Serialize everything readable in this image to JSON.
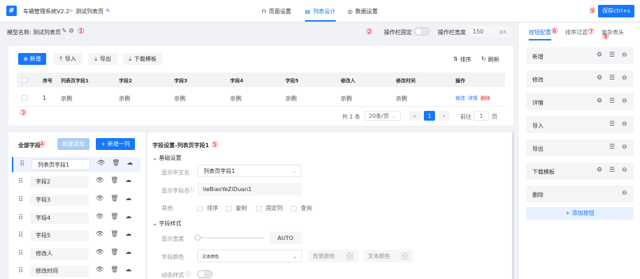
{
  "topbar": {
    "crumbs": [
      "车辆管理系统V2.2",
      ">",
      "测试列表页"
    ],
    "tabs": [
      {
        "label": "页面设置",
        "icon": "bookmark-icon"
      },
      {
        "label": "列表设计",
        "icon": "document-icon"
      },
      {
        "label": "数据设置",
        "icon": "database-icon"
      }
    ],
    "active_tab": 1,
    "save_label": "保存ctrl+s",
    "marker": "⑨"
  },
  "model": {
    "label": "模型名称:",
    "name": "测试列表页",
    "marker": "①",
    "fixed_label": "操作栏固定",
    "fixed_marker": "②",
    "width_label": "操作栏宽度",
    "width_value": "150",
    "width_unit": "px"
  },
  "toolbar": {
    "add": "新增",
    "import": "导入",
    "export": "导出",
    "template": "下载模板",
    "sort": "排序",
    "refresh": "刷新"
  },
  "table": {
    "headers": [
      "序号",
      "列表页字段1",
      "字段2",
      "字段3",
      "字段4",
      "字段5",
      "修改人",
      "修改时间",
      "操作"
    ],
    "row": [
      "1",
      "示例",
      "示例",
      "示例",
      "示例",
      "示例",
      "示例",
      "示例"
    ],
    "actions": [
      "修改",
      "详情",
      "删除"
    ],
    "marker": "③"
  },
  "pagination": {
    "total": "共 1 条",
    "page_size": "20条/页",
    "current": "1",
    "goto_label": "前往",
    "goto_value": "1",
    "page_unit": "页"
  },
  "fields": {
    "title": "全部字段",
    "marker": "④",
    "batch_add": "批量添加",
    "add_column": "+ 新增一列",
    "items": [
      "列表页字段1",
      "字段2",
      "字段3",
      "字段4",
      "字段5",
      "修改人",
      "修改时间"
    ]
  },
  "settings": {
    "title": "字段设置-列表页字段1",
    "marker": "⑤",
    "basic_section": "基础设置",
    "display_cn_label": "显示中文名",
    "display_cn_value": "列表页字段1",
    "field_name_label": "显示字段名",
    "field_name_value": "lieBiaoYeZiDuan1",
    "other_label": "其他",
    "options": [
      "排序",
      "复制",
      "固定列",
      "查询"
    ],
    "style_section": "字段样式",
    "width_label": "显示宽度",
    "width_value": "AUTO",
    "color_label": "字段颜色",
    "color_value": "文本颜色",
    "bg_color": "背景颜色",
    "text_color": "文本颜色",
    "dynamic_label": "动态样式"
  },
  "right": {
    "tabs": [
      "按钮配置",
      "排序过滤",
      "复杂表头"
    ],
    "markers": [
      "⑥",
      "⑦",
      "⑧"
    ],
    "buttons": [
      "新增",
      "修改",
      "详情",
      "导入",
      "导出",
      "下载模板",
      "删除"
    ],
    "add_button": "+ 添加按钮"
  }
}
